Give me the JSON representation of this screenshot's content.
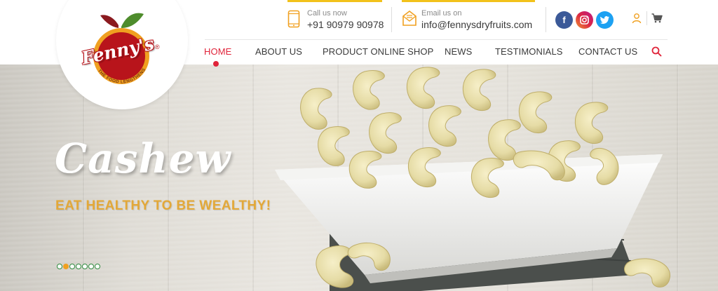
{
  "brand": {
    "name": "Fenny's",
    "registered": "®",
    "tagline": "THE FOOD LENGTHENS LIFE"
  },
  "contact": {
    "call": {
      "label": "Call us now",
      "value": "+91 90979 90978",
      "icon": "phone-icon"
    },
    "email": {
      "label": "Email us on",
      "value": "info@fennysdryfruits.com",
      "icon": "email-icon"
    }
  },
  "social": [
    {
      "name": "facebook",
      "glyph": "f",
      "color": "#3b5998"
    },
    {
      "name": "instagram",
      "glyph": "◎",
      "color": "#c13584"
    },
    {
      "name": "twitter",
      "glyph": "🐦",
      "color": "#1da1f2"
    }
  ],
  "utility": {
    "account_icon": "user-icon",
    "cart_icon": "cart-icon"
  },
  "nav": {
    "items": [
      {
        "label": "HOME",
        "active": true
      },
      {
        "label": "ABOUT US",
        "active": false
      },
      {
        "label": "PRODUCT ONLINE SHOP",
        "active": false
      },
      {
        "label": "NEWS",
        "active": false
      },
      {
        "label": "TESTIMONIALS",
        "active": false
      },
      {
        "label": "CONTACT US",
        "active": false
      }
    ],
    "search_icon": "search-icon"
  },
  "hero": {
    "title": "Cashew",
    "subtitle": "EAT HEALTHY TO BE WEALTHY!",
    "slides_total": 7,
    "active_slide": 2
  },
  "colors": {
    "accent": "#e0243a",
    "brand_red": "#b8141b",
    "gold": "#e3a838",
    "bar_yellow": "#f2c21b",
    "dot_green": "#2e8b3e",
    "dot_orange": "#f0a020"
  }
}
